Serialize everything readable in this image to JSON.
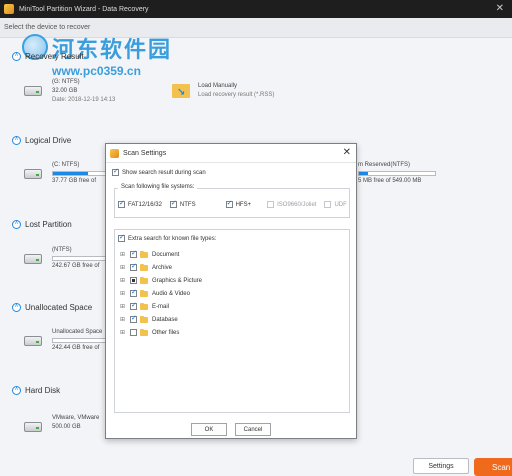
{
  "window": {
    "title": "MiniTool Partition Wizard - Data Recovery",
    "close_glyph": "✕"
  },
  "subheader": {
    "text": "Select the device to recover"
  },
  "watermark": {
    "title": "河东软件园",
    "url": "www.pc0359.cn"
  },
  "recovery_result": {
    "section": "Recovery Result",
    "drive": {
      "name": "(G: NTFS)",
      "size": "32.00 GB",
      "date": "Date: 2018-12-19 14:13"
    },
    "load": {
      "title": "Load Manually",
      "desc": "Load recovery result (*.RSS)"
    }
  },
  "logical_drive": {
    "section": "Logical Drive",
    "drives": [
      {
        "name": "(C: NTFS)",
        "free": "37.77 GB free of",
        "usage": 0.6
      },
      {
        "name": "m Reserved(NTFS)",
        "free": "5 MB free of 549.00 MB",
        "usage": 0.12
      }
    ]
  },
  "lost_partition": {
    "section": "Lost Partition",
    "drive": {
      "name": "(NTFS)",
      "free": "242.67 GB free of"
    }
  },
  "unallocated": {
    "section": "Unallocated Space",
    "drive": {
      "name": "Unallocated Space",
      "free": "242.44 GB free of"
    }
  },
  "hard_disk": {
    "section": "Hard Disk",
    "drive": {
      "name": "VMware, VMware",
      "size": "500.00 GB"
    }
  },
  "bottom": {
    "settings_label": "Settings",
    "scan_label": "Scan"
  },
  "dialog": {
    "title": "Scan Settings",
    "close_glyph": "✕",
    "show_search_label": "Show search result during scan",
    "fs_legend": "Scan following file systems:",
    "fs": [
      {
        "label": "FAT12/16/32",
        "checked": true
      },
      {
        "label": "NTFS",
        "checked": true
      },
      {
        "label": "HFS+",
        "checked": true
      },
      {
        "label": "ISO9660/Joliet",
        "checked": false
      },
      {
        "label": "UDF",
        "checked": false
      }
    ],
    "extra_label": "Extra search for known file types:",
    "types": [
      {
        "label": "Document",
        "state": "checked"
      },
      {
        "label": "Archive",
        "state": "checked"
      },
      {
        "label": "Graphics & Picture",
        "state": "partial"
      },
      {
        "label": "Audio & Video",
        "state": "checked"
      },
      {
        "label": "E-mail",
        "state": "checked"
      },
      {
        "label": "Database",
        "state": "checked"
      },
      {
        "label": "Other files",
        "state": "unchecked"
      }
    ],
    "ok_label": "OK",
    "cancel_label": "Cancel"
  }
}
